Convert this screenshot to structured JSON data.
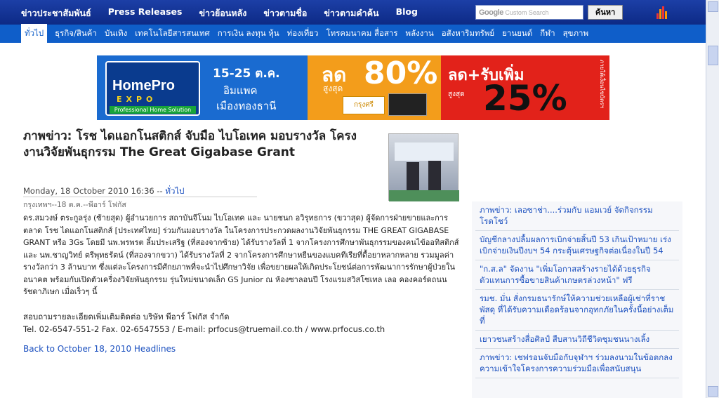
{
  "topnav": {
    "items": [
      "ข่าวประชาสัมพันธ์",
      "Press Releases",
      "ข่าวย้อนหลัง",
      "ข่าวตามชื่อ",
      "ข่าวตามคำค้น",
      "Blog"
    ],
    "search_brand": "Google",
    "search_placeholder": "Custom Search",
    "search_button": "ค้นหา"
  },
  "subnav": {
    "items": [
      "ทั่วไป",
      "ธุรกิจ/สินค้า",
      "บันเทิง",
      "เทคโนโลยีสารสนเทศ",
      "การเงิน ลงทุน หุ้น",
      "ท่องเที่ยว",
      "โทรคมนาคม สื่อสาร",
      "พลังงาน",
      "อสังหาริมทรัพย์",
      "ยานยนต์",
      "กีฬา",
      "สุขภาพ"
    ]
  },
  "banner": {
    "logo_top": "HomePro",
    "logo_mid": "EXPO",
    "logo_bottom": "Professional Home Solution",
    "dates": "15-25 ต.ค.",
    "venue1": "อิมแพค",
    "venue2": "เมืองทองธานี",
    "discount_label": "ลด",
    "discount_pct": "80%",
    "discount_sub": "สูงสุด",
    "bank": "กรุงศรี",
    "extra_label": "ลด+รับเพิ่ม",
    "extra_pct": "25%",
    "extra_sub": "สูงสุด",
    "vertical": "ภายใต้เงื่อนไขบัตรฯ"
  },
  "article": {
    "title": "ภาพข่าว: โรช ไดแอกโนสติกส์ จับมือ ไบโอเทค มอบรางวัล โครงงานวิจัยพันธุกรรม The Great Gigabase Grant",
    "date": "Monday, 18 October 2010 16:36 -- ",
    "category": "ทั่วไป",
    "author": "กรุงเทพฯ--18 ต.ค.--พีอาร์ โฟกัส",
    "body": "ดร.สมวงษ์ ตระกูลรุ่ง (ซ้ายสุด) ผู้อำนวยการ สถาบันจีโนม ไบโอเทค และ นายชนก อวิรุทธการ (ขวาสุด) ผู้จัดการฝ่ายขายและการตลาด โรช ไดแอกโนสติกส์ [ประเทศไทย] ร่วมกันมอบรางวัล ในโครงการประกวดผลงานวิจัยพันธุกรรม THE GREAT GIGABASE GRANT หรือ 3Gs โดยมี นพ.พรพรต ลิ้มประเสริฐ (ที่สองจากซ้าย) ได้รับรางวัลที่ 1 จากโครงการศึกษาพันธุกรรมของคนไข้ออทิสติกส์ และ นพ.ชาญวิทย์ ตรีพุทธรัตน์ (ที่สองจากขวา) ได้รับรางวัลที่ 2 จากโครงการศึกษาหยีนของแบคทีเรียที่ดื้อยาหลากหลาย รวมมูลค่ารางวัลกว่า 3 ล้านบาท ซึ่งแต่ละโครงการมีศักยภาพที่จะนำไปศึกษาวิจัย เพื่อขยายผลให้เกิดประโยชน์ต่อการพัฒนาการรักษาผู้ป่วยในอนาคต พร้อมกับเปิดตัวเครื่องวิจัยพันธุกรรม รุ่นใหม่ขนาดเล็ก GS Junior ณ ห้องซาลอนปี โรงแรมสวิสโซเทล เลอ คองคอร์ดถนนรัชดาภิเษก เมื่อเร็วๆ นี้",
    "contact1": "สอบถามรายละเอียดเพิ่มเติมติดต่อ บริษัท พีอาร์ โฟกัส จำกัด",
    "contact2": "Tel. 02-6547-551-2 Fax. 02-6547553 / E-mail: prfocus@truemail.co.th / www.prfocus.co.th",
    "back": "Back to October 18, 2010 Headlines"
  },
  "sidebar": {
    "items": [
      "ภาพข่าว: เลอซาช่า....ร่วมกับ แอมเวย์ จัดกิจกรรมโรดโชว์",
      "บัญชีกลางปลื้มผลการเบิกจ่ายสิ้นปี 53 เกินเป้าหมาย เร่งเบิกจ่ายเงินปีงบฯ 54 กระตุ้นเศรษฐกิจต่อเนื่องในปี 54",
      "\"ก.ส.ล\" จัดงาน \"เพิ่มโอกาสสร้างรายได้ด้วยธุรกิจตัวแทนการซื้อขายสินค้าเกษตรล่วงหน้า\" ฟรี",
      "รมช. มั่น สั่งกรมธนารักษ์ให้ความช่วยเหลือผู้เช่าที่ราชพัสดุ ที่ได้รับความเดือดร้อนจากอุทกภัยในครั้งนี้อย่างเต็มที่",
      "เยาวชนสร้างสื่อศิลป์ สืบสานวิถีชีวิตชุมชนนางเลิ้ง",
      "ภาพข่าว: เชฟรอนจับมือกับจุฬาฯ ร่วมลงนามในข้อตกลงความเข้าใจโครงการความร่วมมือเพื่อสนับสนุน"
    ]
  },
  "colors": {
    "topbar": "#1c3fa6",
    "subbar": "#0f5ec9",
    "link": "#1a4fbf"
  }
}
